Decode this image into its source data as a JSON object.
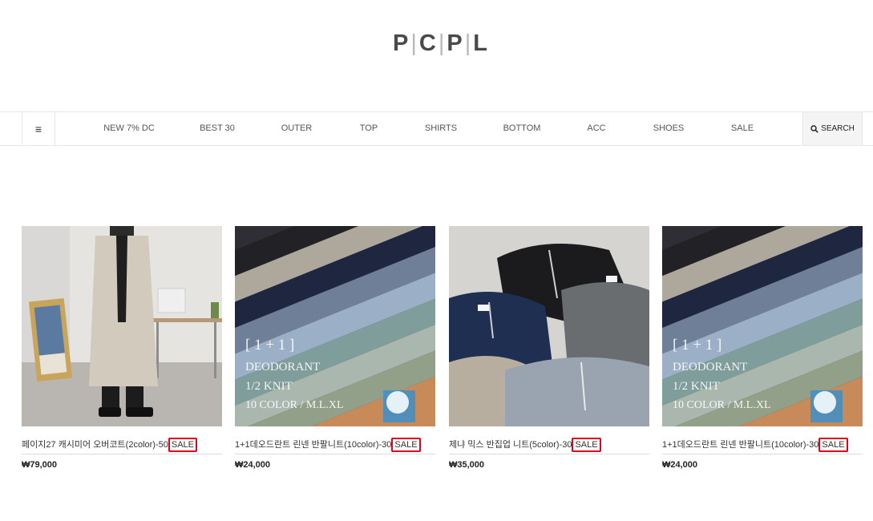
{
  "header": {
    "logo_letters": [
      "P",
      "C",
      "P",
      "L"
    ]
  },
  "nav": {
    "menu_icon": "hamburger-icon",
    "items": [
      "NEW 7% DC",
      "BEST 30",
      "OUTER",
      "TOP",
      "SHIRTS",
      "BOTTOM",
      "ACC",
      "SHOES",
      "SALE"
    ],
    "search_label": "SEARCH",
    "search_icon": "search-icon"
  },
  "products": [
    {
      "name": "페이지27 캐시미어 오버코트(2color)-50",
      "badge": "SALE",
      "price": "₩79,000"
    },
    {
      "name": "1+1데오드란트 린넨 반팔니트(10color)-30",
      "badge": "SALE",
      "price": "₩24,000",
      "overlay": {
        "line1": "[ 1 + 1 ]",
        "line2": "DEODORANT",
        "line3": "1/2 KNIT",
        "line4": "10 COLOR / M.L.XL"
      }
    },
    {
      "name": "제냐 믹스 반집업 니트(5color)-30",
      "badge": "SALE",
      "price": "₩35,000"
    },
    {
      "name": "1+1데오드란트 린넨 반팔니트(10color)-30",
      "badge": "SALE",
      "price": "₩24,000",
      "overlay": {
        "line1": "[ 1 + 1 ]",
        "line2": "DEODORANT",
        "line3": "1/2 KNIT",
        "line4": "10 COLOR / M.L.XL"
      }
    }
  ],
  "colors": {
    "sale_border": "#e0001a",
    "nav_border": "#e6e6e6",
    "search_bg": "#f4f4f4"
  }
}
